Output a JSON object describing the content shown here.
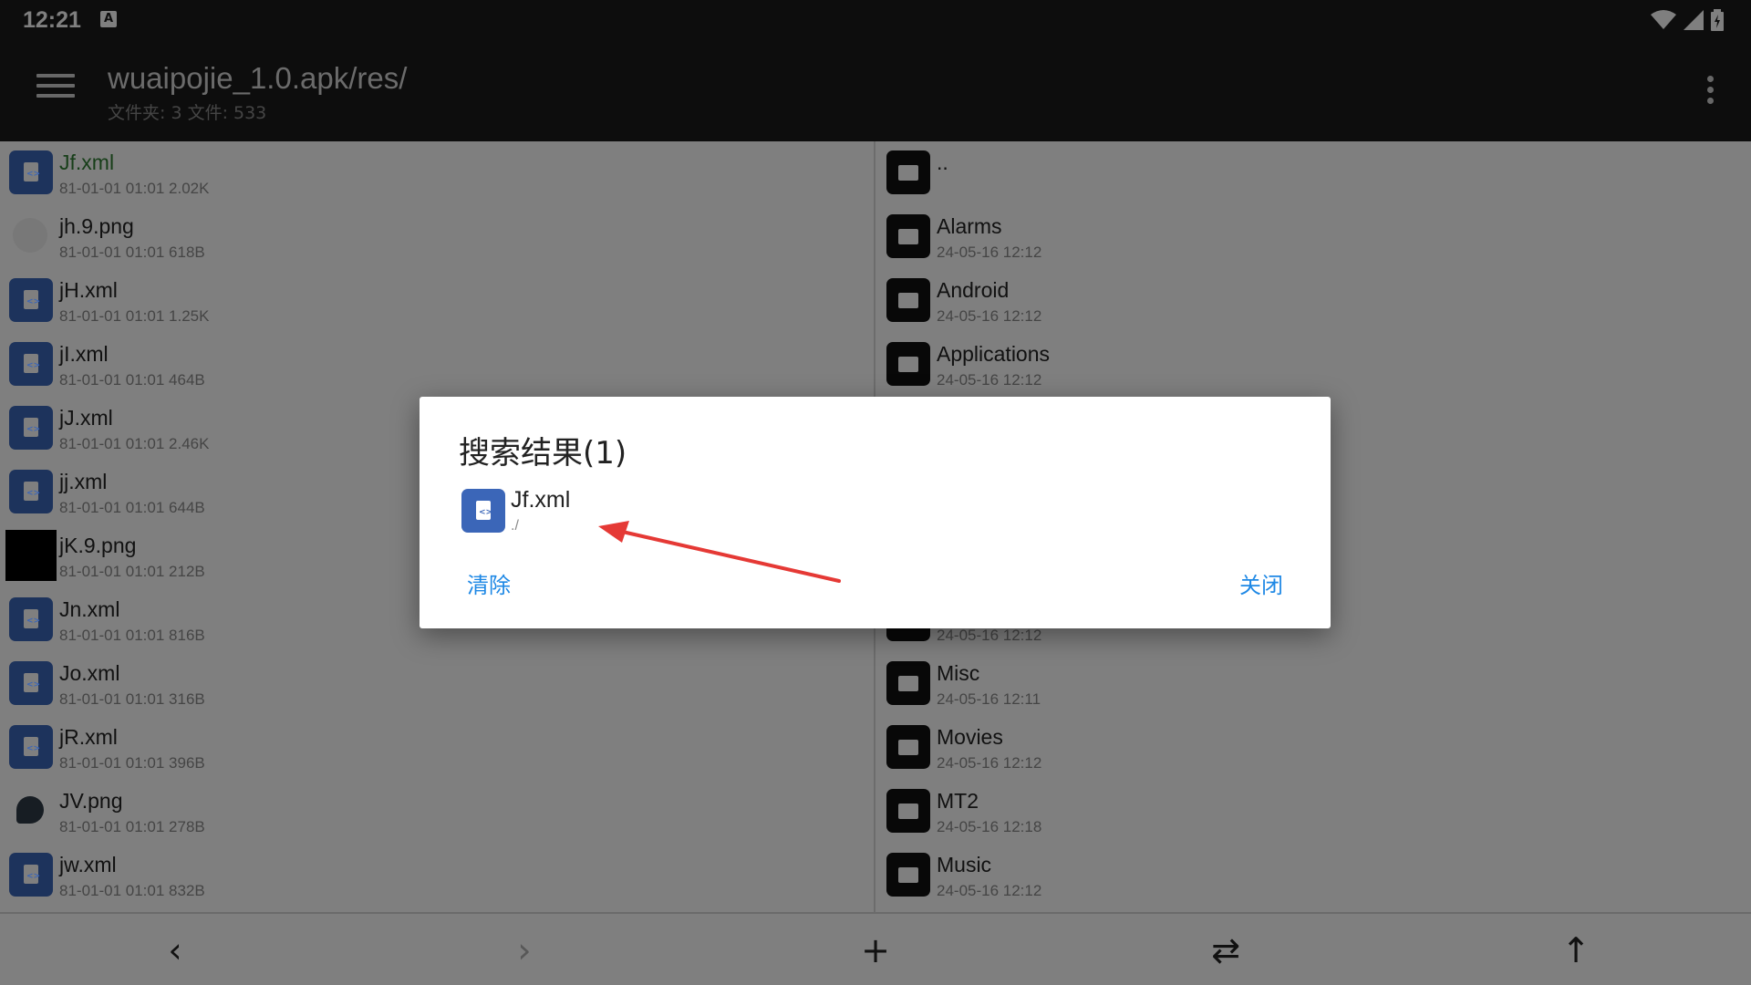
{
  "status": {
    "time": "12:21",
    "a_icon": "A"
  },
  "toolbar": {
    "title": "wuaipojie_1.0.apk/res/",
    "subtitle": "文件夹: 3  文件: 533",
    "menu_icon": "hamburger-menu-icon",
    "more_icon": "more-vert-icon"
  },
  "left_pane": {
    "items": [
      {
        "name": "Jf.xml",
        "meta": "81-01-01 01:01  2.02K",
        "icon": "xml-file-icon",
        "selected": true
      },
      {
        "name": "jh.9.png",
        "meta": "81-01-01 01:01  618B",
        "icon": "image-thumb"
      },
      {
        "name": "jH.xml",
        "meta": "81-01-01 01:01  1.25K",
        "icon": "xml-file-icon"
      },
      {
        "name": "jI.xml",
        "meta": "81-01-01 01:01  464B",
        "icon": "xml-file-icon"
      },
      {
        "name": "jJ.xml",
        "meta": "81-01-01 01:01  2.46K",
        "icon": "xml-file-icon"
      },
      {
        "name": "jj.xml",
        "meta": "81-01-01 01:01  644B",
        "icon": "xml-file-icon"
      },
      {
        "name": "jK.9.png",
        "meta": "81-01-01 01:01  212B",
        "icon": "image-thumb-black"
      },
      {
        "name": "Jn.xml",
        "meta": "81-01-01 01:01  816B",
        "icon": "xml-file-icon"
      },
      {
        "name": "Jo.xml",
        "meta": "81-01-01 01:01  316B",
        "icon": "xml-file-icon"
      },
      {
        "name": "jR.xml",
        "meta": "81-01-01 01:01  396B",
        "icon": "xml-file-icon"
      },
      {
        "name": "JV.png",
        "meta": "81-01-01 01:01  278B",
        "icon": "image-thumb-drop"
      },
      {
        "name": "jw.xml",
        "meta": "81-01-01 01:01  832B",
        "icon": "xml-file-icon"
      }
    ]
  },
  "right_pane": {
    "items": [
      {
        "name": "..",
        "meta": ""
      },
      {
        "name": "Alarms",
        "meta": "24-05-16 12:12"
      },
      {
        "name": "Android",
        "meta": "24-05-16 12:12"
      },
      {
        "name": "Applications",
        "meta": "24-05-16 12:12"
      },
      {
        "name": "",
        "meta": ""
      },
      {
        "name": "",
        "meta": ""
      },
      {
        "name": "",
        "meta": ""
      },
      {
        "name": "",
        "meta": "24-05-16 12:12"
      },
      {
        "name": "Misc",
        "meta": "24-05-16 12:11"
      },
      {
        "name": "Movies",
        "meta": "24-05-16 12:12"
      },
      {
        "name": "MT2",
        "meta": "24-05-16 12:18"
      },
      {
        "name": "Music",
        "meta": "24-05-16 12:12"
      }
    ]
  },
  "bottom_bar": {
    "back": "‹",
    "forward": "›",
    "add": "+",
    "swap": "⇄",
    "up": "↑"
  },
  "dialog": {
    "title": "搜索结果(1)",
    "result_name": "Jf.xml",
    "result_path": "./",
    "clear_label": "清除",
    "close_label": "关闭"
  },
  "colors": {
    "toolbar_bg": "#1a1a1a",
    "accent": "#1e88e5",
    "file_icon": "#3b66b8",
    "selected_text": "#2e7d32",
    "annotation_arrow": "#e53935"
  }
}
